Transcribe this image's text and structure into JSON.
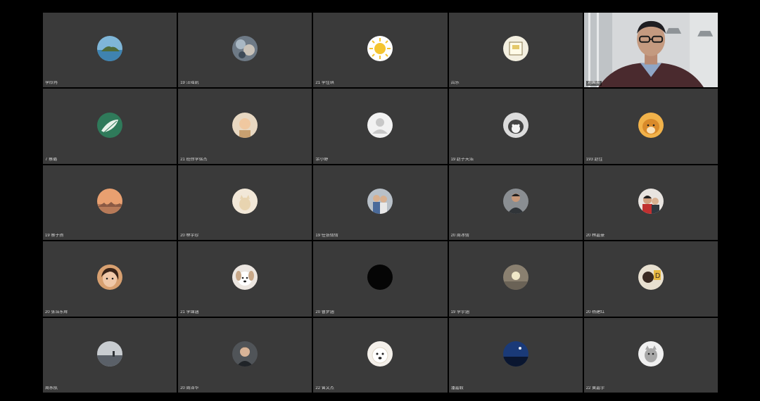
{
  "colors": {
    "background": "#000000",
    "tile": "#3a3a3a",
    "active_speaker_border": "#3fbf5a",
    "name_text": "#d8d8d8"
  },
  "participants": [
    {
      "name": "李欣冉",
      "avatar": "island-sea-photo"
    },
    {
      "name": "19 汪瑶凯",
      "avatar": "cartoon-collage-photo"
    },
    {
      "name": "21 李佳琪",
      "avatar": "sun-cartoon"
    },
    {
      "name": "吕乐",
      "avatar": "paper-sketch-photo"
    },
    {
      "name": "刘国英",
      "avatar": "camera-video",
      "video": true
    },
    {
      "name": "7 蔡璐",
      "avatar": "leaf-green-photo"
    },
    {
      "name": "21 班徐李铭杰",
      "avatar": "child-portrait"
    },
    {
      "name": "余小野",
      "avatar": "default-user-icon"
    },
    {
      "name": "19 赵子天浩",
      "avatar": "husky-dog-photo"
    },
    {
      "name": "193 赵佳",
      "avatar": "shiba-dog-photo"
    },
    {
      "name": "19 蔡子扬",
      "avatar": "sunset-sky-photo"
    },
    {
      "name": "20 林宇珍",
      "avatar": "cat-in-light-photo"
    },
    {
      "name": "19 任张倩倩",
      "avatar": "couple-photo"
    },
    {
      "name": "20 周冰倩",
      "avatar": "man-portrait"
    },
    {
      "name": "20 林嘉豪",
      "avatar": "two-people-photo"
    },
    {
      "name": "20 张浩东辉",
      "avatar": "girl-selfie"
    },
    {
      "name": "21 李锦涵",
      "avatar": "puppy-dog-photo"
    },
    {
      "name": "20 曹梦涵",
      "avatar": "black-circle"
    },
    {
      "name": "19 李宇涵",
      "avatar": "moon-light-photo"
    },
    {
      "name": "20 杨建红",
      "avatar": "letter-d-photo"
    },
    {
      "name": "周永航",
      "avatar": "landscape-photo"
    },
    {
      "name": "20 周泽华",
      "avatar": "boy-portrait"
    },
    {
      "name": "22 曾文杰",
      "avatar": "white-dog-photo"
    },
    {
      "name": "潘嘉毅",
      "avatar": "night-sky-photo"
    },
    {
      "name": "22 黄嘉宇",
      "avatar": "animal-drawing"
    }
  ]
}
